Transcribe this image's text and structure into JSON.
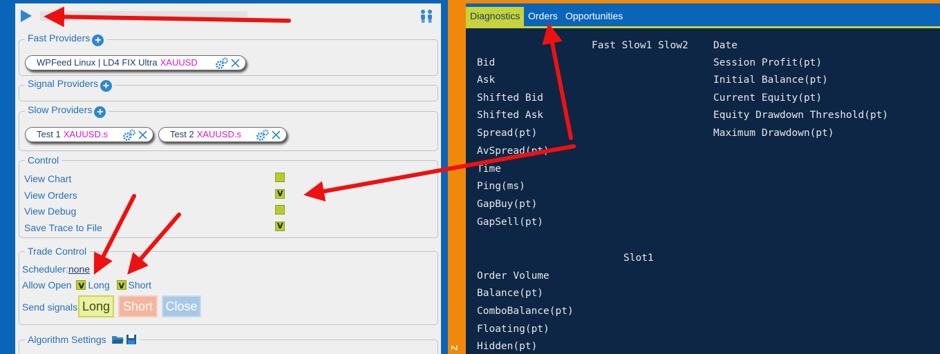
{
  "left": {
    "fast_providers": {
      "title": "Fast Providers",
      "pills": [
        {
          "name": "WPFeed Linux | LD4 FIX Ultra",
          "symbol": "XAUUSD"
        }
      ]
    },
    "signal_providers": {
      "title": "Signal Providers"
    },
    "slow_providers": {
      "title": "Slow Providers",
      "pills": [
        {
          "name": "Test 1",
          "symbol": "XAUUSD.s"
        },
        {
          "name": "Test 2",
          "symbol": "XAUUSD.s"
        }
      ]
    },
    "control": {
      "title": "Control",
      "items": [
        {
          "label": "View Chart",
          "checked": false
        },
        {
          "label": "View Orders",
          "checked": true
        },
        {
          "label": "View Debug",
          "checked": false
        },
        {
          "label": "Save Trace to File",
          "checked": true
        }
      ]
    },
    "trade_control": {
      "title": "Trade Control",
      "scheduler_label": "Scheduler:",
      "scheduler_value": "none",
      "allow_open_label": "Allow Open",
      "long_label": "Long",
      "short_label": "Short",
      "long_checked": true,
      "short_checked": true,
      "send_signals_label": "Send signals:",
      "buttons": {
        "long": "Long",
        "short": "Short",
        "close": "Close"
      }
    },
    "algorithm_settings": {
      "title": "Algorithm Settings"
    }
  },
  "right": {
    "tabs": [
      {
        "label": "Diagnostics",
        "active": true
      },
      {
        "label": "Orders",
        "active": false
      },
      {
        "label": "Opportunities",
        "active": false
      }
    ],
    "column_header": "Fast Slow1 Slow2",
    "left_rows": [
      "Bid",
      "Ask",
      "Shifted Bid",
      "Shifted Ask",
      "Spread(pt)",
      "AvSpread(pt)",
      "Time",
      "Ping(ms)",
      "GapBuy(pt)",
      "GapSell(pt)"
    ],
    "right_rows": [
      "Date",
      "Session Profit(pt)",
      "Initial Balance(pt)",
      "Current Equity(pt)",
      "Equity Drawdown Threshold(pt)",
      "Maximum Drawdown(pt)"
    ],
    "slot_header": "Slot1",
    "slot_rows": [
      "Order Volume",
      "Balance(pt)",
      "ComboBalance(pt)",
      "Floating(pt)",
      "Hidden(pt)"
    ],
    "vertical_label": "Z"
  },
  "colors": {
    "blue": "#0a64b8",
    "orange": "#f0880c",
    "console_bg": "#0d2645",
    "checkbox": "#b8cc30",
    "symbol_magenta": "#d314d3",
    "arrow_red": "#ee1111"
  }
}
